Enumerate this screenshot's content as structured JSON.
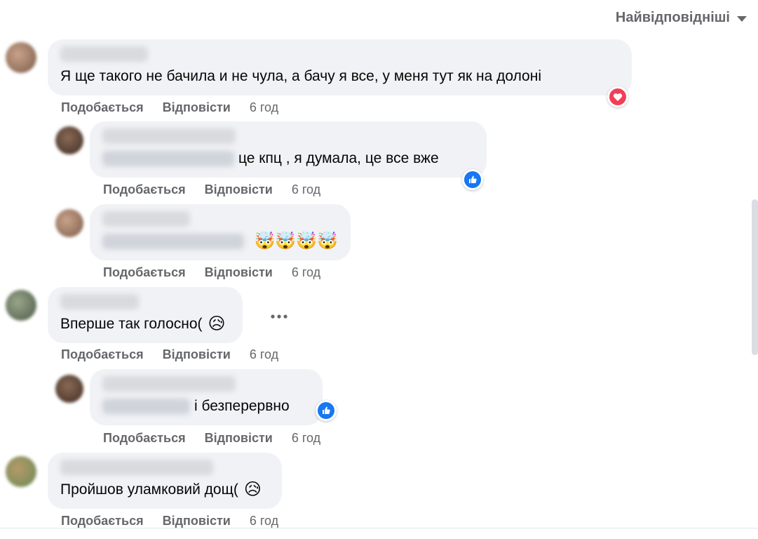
{
  "sort": {
    "label": "Найвідповідніші"
  },
  "actions": {
    "like": "Подобається",
    "reply": "Відповісти"
  },
  "comments": [
    {
      "text": "Я ще такого не бачила и не чула, а бачу я все, у меня тут як на долоні",
      "time": "6 год",
      "reaction": "love-icon"
    },
    {
      "text": "це кпц , я думала, це все вже",
      "time": "6 год",
      "reaction": "like-icon"
    },
    {
      "text": "🤯🤯🤯🤯",
      "time": "6 год"
    },
    {
      "text": "Вперше так голосно(",
      "emoji": "😥",
      "time": "6 год"
    },
    {
      "text": "і безперервно",
      "time": "6 год",
      "reaction": "like-icon"
    },
    {
      "text": "Пройшов уламковий дощ(",
      "emoji": "😥",
      "time": "6 год"
    }
  ],
  "colors": {
    "bubble": "#f0f2f5",
    "meta_text": "#65676b",
    "like_blue": "#1877f2",
    "love_red": "#f33e58"
  }
}
